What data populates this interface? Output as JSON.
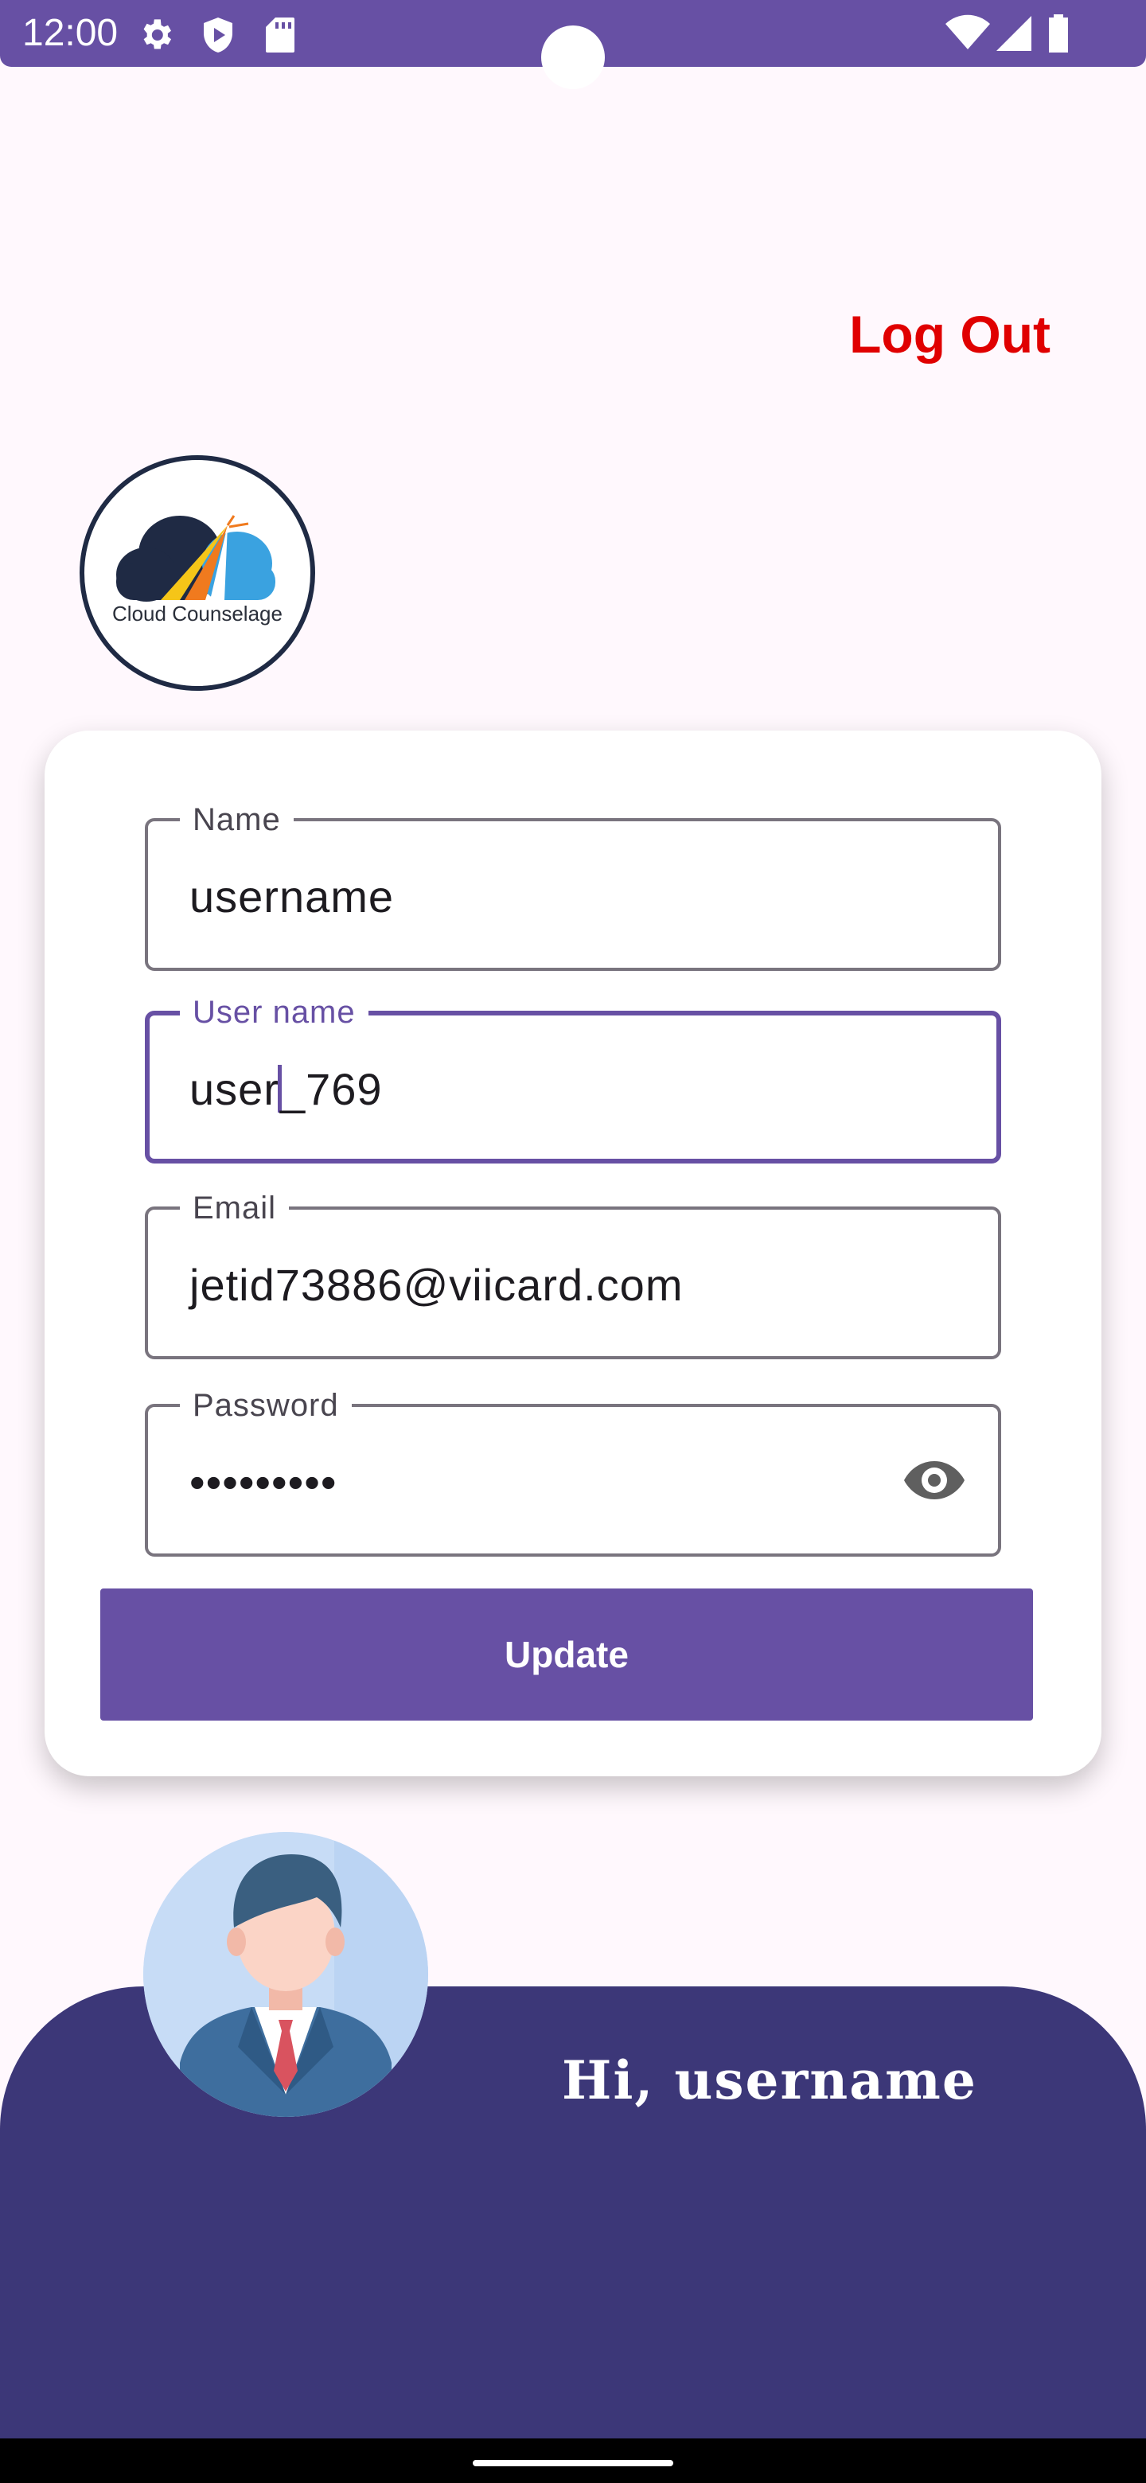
{
  "status_bar": {
    "time": "12:00",
    "left_icons": [
      "gear-icon",
      "play-protect-icon",
      "sd-card-icon"
    ],
    "right_icons": [
      "wifi-icon",
      "signal-icon",
      "battery-icon"
    ]
  },
  "header": {
    "logout_label": "Log Out"
  },
  "logo": {
    "text": "Cloud Counselage"
  },
  "form": {
    "name": {
      "label": "Name",
      "value": "username"
    },
    "user_name": {
      "label": "User name",
      "value_before_caret": "user",
      "value_after_caret": "_769"
    },
    "email": {
      "label": "Email",
      "value": "jetid73886@viicard.com"
    },
    "password": {
      "label": "Password",
      "value": "•••••••••"
    },
    "update_label": "Update"
  },
  "profile": {
    "greeting": "Hi, username"
  },
  "colors": {
    "primary": "#6750a4",
    "logout": "#e00000",
    "panel": "#3c3778"
  }
}
